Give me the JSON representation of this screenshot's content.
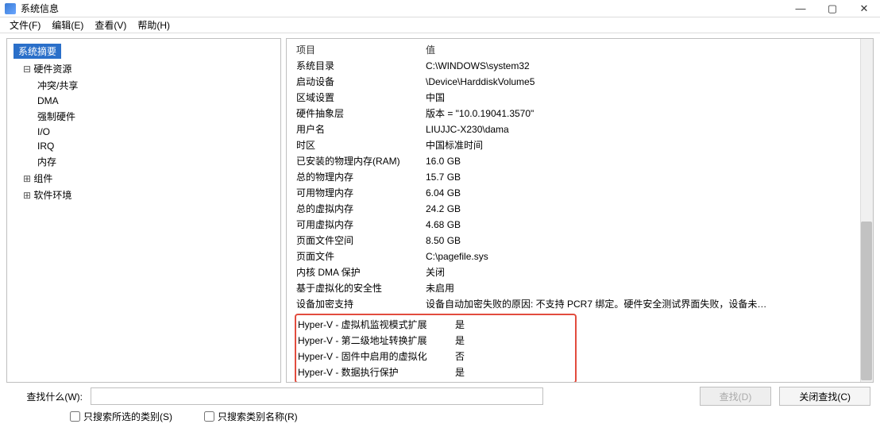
{
  "window": {
    "title": "系统信息",
    "min": "—",
    "max": "▢",
    "close": "✕"
  },
  "menu": {
    "file": "文件(F)",
    "edit": "编辑(E)",
    "view": "查看(V)",
    "help": "帮助(H)"
  },
  "tree": {
    "root": "系统摘要",
    "hardware": "硬件资源",
    "hw_children": [
      "冲突/共享",
      "DMA",
      "强制硬件",
      "I/O",
      "IRQ",
      "内存"
    ],
    "components": "组件",
    "software": "软件环境"
  },
  "detailHeaders": {
    "key": "项目",
    "value": "值"
  },
  "rows": [
    {
      "k": "系统目录",
      "v": "C:\\WINDOWS\\system32"
    },
    {
      "k": "启动设备",
      "v": "\\Device\\HarddiskVolume5"
    },
    {
      "k": "区域设置",
      "v": "中国"
    },
    {
      "k": "硬件抽象层",
      "v": "版本 = \"10.0.19041.3570\""
    },
    {
      "k": "用户名",
      "v": "LIUJJC-X230\\dama"
    },
    {
      "k": "时区",
      "v": "中国标准时间"
    },
    {
      "k": "已安装的物理内存(RAM)",
      "v": "16.0 GB"
    },
    {
      "k": "总的物理内存",
      "v": "15.7 GB"
    },
    {
      "k": "可用物理内存",
      "v": "6.04 GB"
    },
    {
      "k": "总的虚拟内存",
      "v": "24.2 GB"
    },
    {
      "k": "可用虚拟内存",
      "v": "4.68 GB"
    },
    {
      "k": "页面文件空间",
      "v": "8.50 GB"
    },
    {
      "k": "页面文件",
      "v": "C:\\pagefile.sys"
    },
    {
      "k": "内核 DMA 保护",
      "v": "关闭"
    },
    {
      "k": "基于虚拟化的安全性",
      "v": "未启用"
    },
    {
      "k": "设备加密支持",
      "v": "设备自动加密失败的原因: 不支持 PCR7 绑定。硬件安全测试界面失败，设备未…"
    }
  ],
  "hyperv": [
    {
      "k": "Hyper-V - 虚拟机监视模式扩展",
      "v": "是"
    },
    {
      "k": "Hyper-V - 第二级地址转换扩展",
      "v": "是"
    },
    {
      "k": "Hyper-V - 固件中启用的虚拟化",
      "v": "否"
    },
    {
      "k": "Hyper-V - 数据执行保护",
      "v": "是"
    }
  ],
  "footer": {
    "search_label": "查找什么(W):",
    "search_placeholder": "",
    "find_btn": "查找(D)",
    "close_find_btn": "关闭查找(C)",
    "cb_selected_only": "只搜索所选的类别(S)",
    "cb_names_only": "只搜索类别名称(R)"
  }
}
